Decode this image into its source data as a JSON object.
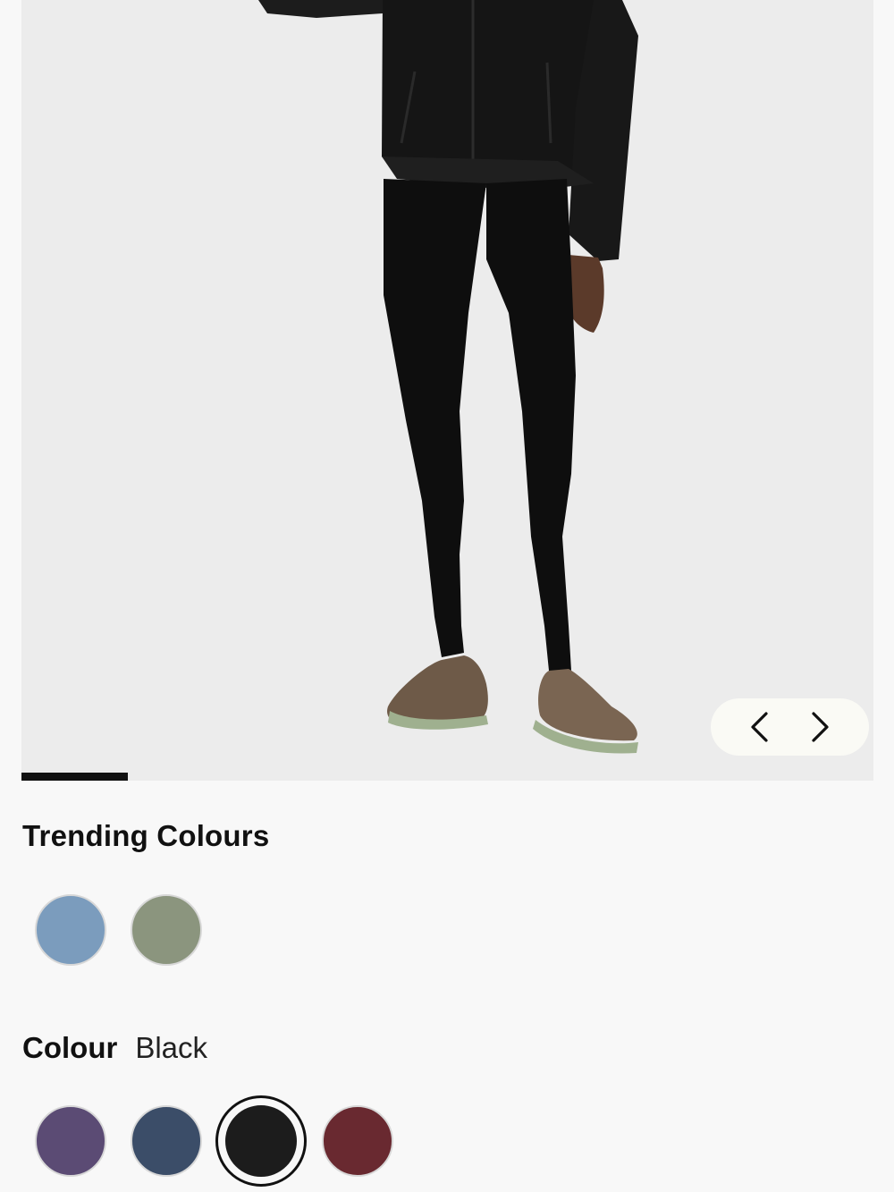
{
  "gallery": {
    "image_alt": "Model wearing black leggings, black jacket and trail shoes",
    "progress": 0.125,
    "prev_icon": "chevron-left-icon",
    "next_icon": "chevron-right-icon"
  },
  "trending": {
    "title": "Trending Colours",
    "swatches": [
      {
        "color": "#7b9cbd"
      },
      {
        "color": "#8b957e"
      }
    ]
  },
  "colour": {
    "label": "Colour",
    "value": "Black",
    "selected_index": 2,
    "swatches": [
      {
        "color": "#5b4b74"
      },
      {
        "color": "#3b4d68"
      },
      {
        "color": "#1c1c1c"
      },
      {
        "color": "#692930"
      }
    ]
  }
}
